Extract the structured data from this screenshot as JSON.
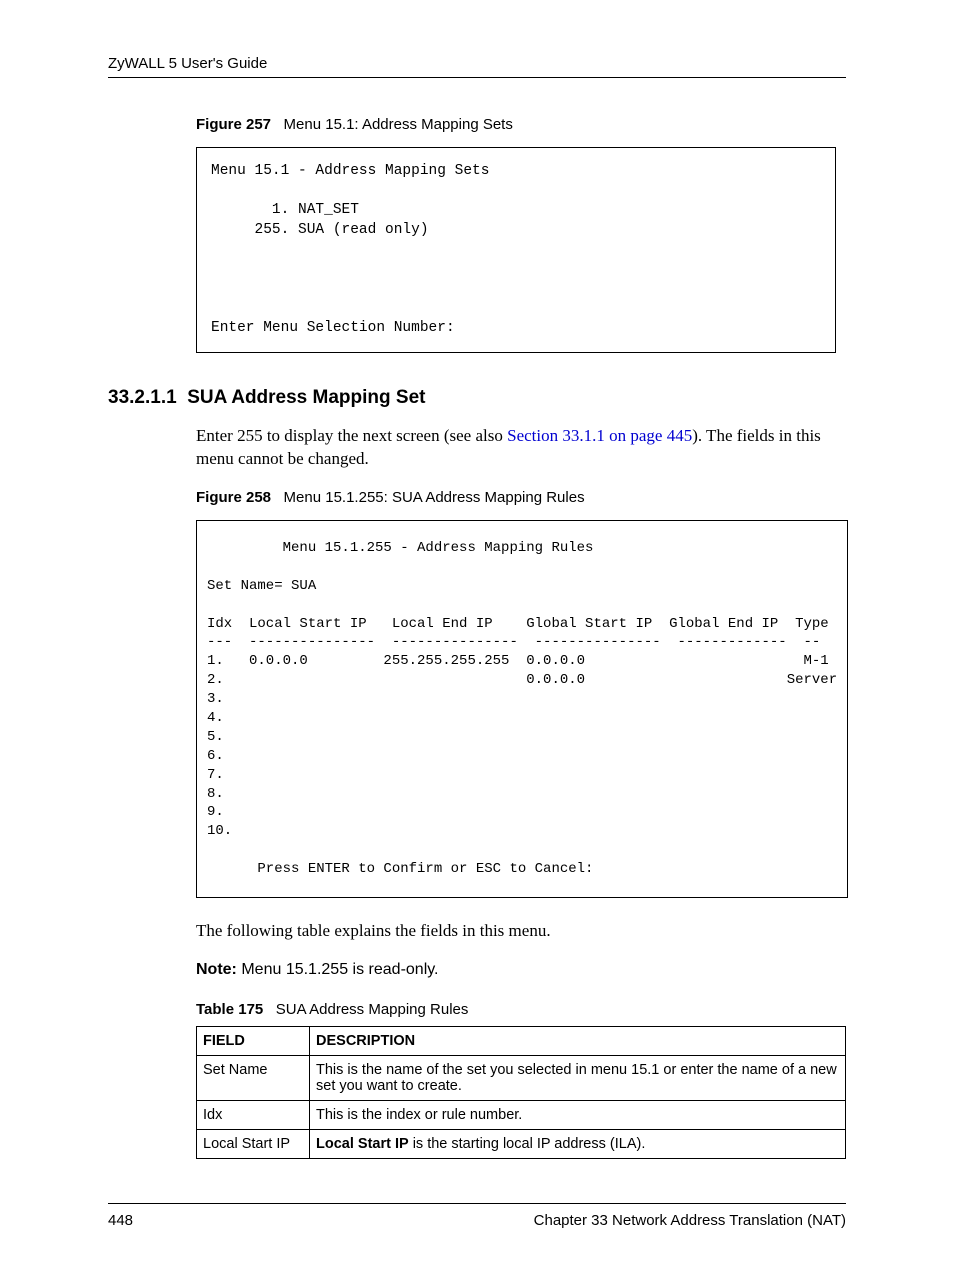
{
  "header": {
    "title": "ZyWALL 5 User's Guide"
  },
  "figure257": {
    "label": "Figure 257",
    "caption": "Menu 15.1: Address Mapping Sets",
    "content": "Menu 15.1 - Address Mapping Sets\n\n       1. NAT_SET\n     255. SUA (read only)\n\n\n\n\nEnter Menu Selection Number:"
  },
  "section": {
    "number": "33.2.1.1",
    "title": "SUA Address Mapping Set"
  },
  "intro_text": {
    "before_link": "Enter 255 to display the next screen (see also ",
    "link": "Section 33.1.1 on page 445",
    "after_link": "). The fields in this menu cannot be changed."
  },
  "figure258": {
    "label": "Figure 258",
    "caption": "Menu 15.1.255: SUA Address Mapping Rules",
    "content": "         Menu 15.1.255 - Address Mapping Rules\n\nSet Name= SUA\n\nIdx  Local Start IP   Local End IP    Global Start IP  Global End IP  Type\n---  ---------------  ---------------  ---------------  -------------  --\n1.   0.0.0.0         255.255.255.255  0.0.0.0                          M-1\n2.                                    0.0.0.0                        Server\n3.\n4.\n5.\n6.\n7.\n8.\n9.\n10.\n\n      Press ENTER to Confirm or ESC to Cancel:"
  },
  "after_figure_text": "The following table explains the fields in this menu.",
  "note": {
    "label": "Note:",
    "text": "Menu 15.1.255 is read-only."
  },
  "table175": {
    "label": "Table 175",
    "caption": "SUA Address Mapping Rules",
    "header_field": "FIELD",
    "header_desc": "DESCRIPTION",
    "rows": [
      {
        "field": "Set Name",
        "desc_plain": "This is the name of the set you selected in menu 15.1 or enter the name of a new set you want to create."
      },
      {
        "field": "Idx",
        "desc_plain": "This is the index or rule number."
      },
      {
        "field": "Local Start IP",
        "desc_bold": "Local Start IP",
        "desc_rest": " is the starting local IP address (ILA)."
      }
    ]
  },
  "footer": {
    "page_number": "448",
    "chapter": "Chapter 33 Network Address Translation (NAT)"
  }
}
